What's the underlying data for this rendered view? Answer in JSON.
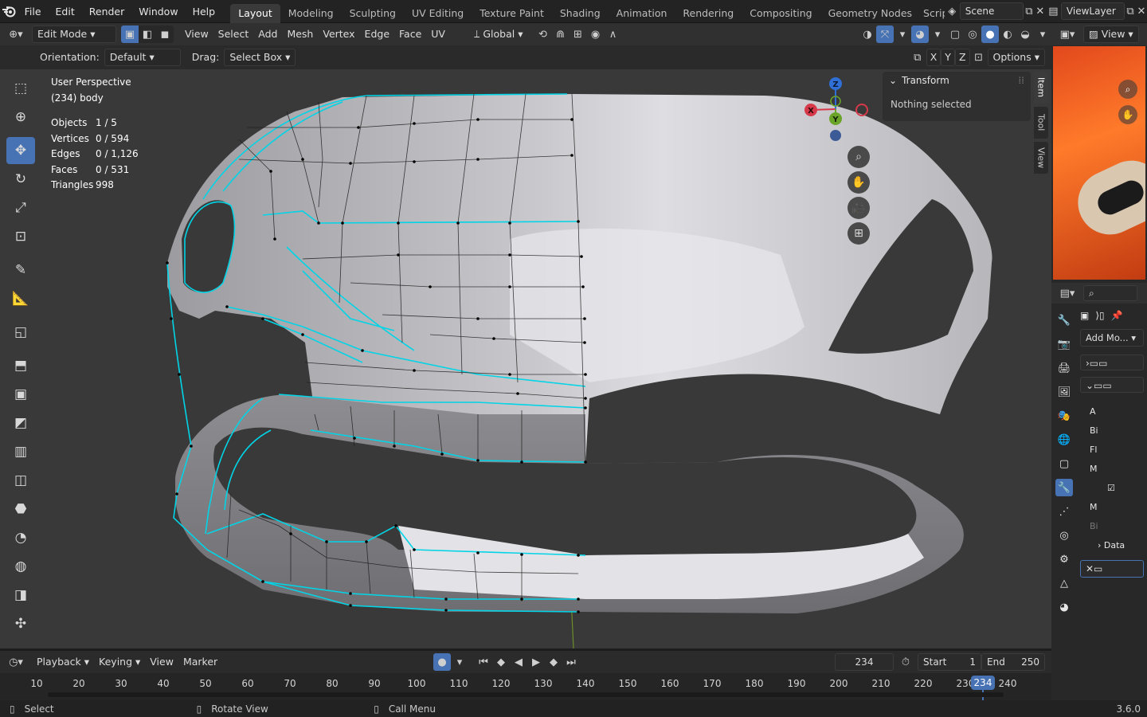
{
  "topbar": {
    "menus": [
      "File",
      "Edit",
      "Render",
      "Window",
      "Help"
    ],
    "workspaces": [
      "Layout",
      "Modeling",
      "Sculpting",
      "UV Editing",
      "Texture Paint",
      "Shading",
      "Animation",
      "Rendering",
      "Compositing",
      "Geometry Nodes",
      "Scripting"
    ],
    "active_workspace": "Layout",
    "scene": "Scene",
    "view_layer": "ViewLayer"
  },
  "header": {
    "mode": "Edit Mode",
    "menus": [
      "View",
      "Select",
      "Add",
      "Mesh",
      "Vertex",
      "Edge",
      "Face",
      "UV"
    ],
    "transform_orientation": "Global"
  },
  "tool_settings": {
    "orientation_label": "Orientation:",
    "orientation_value": "Default",
    "drag_label": "Drag:",
    "drag_value": "Select Box",
    "axes": [
      "X",
      "Y",
      "Z"
    ],
    "options_label": "Options"
  },
  "overlay": {
    "view_name": "User Perspective",
    "object_name": "(234) body",
    "stats": [
      {
        "label": "Objects",
        "value": "1 / 5"
      },
      {
        "label": "Vertices",
        "value": "0 / 594"
      },
      {
        "label": "Edges",
        "value": "0 / 1,126"
      },
      {
        "label": "Faces",
        "value": "0 / 531"
      },
      {
        "label": "Triangles",
        "value": "998"
      }
    ]
  },
  "gizmo": {
    "x": "X",
    "y": "Y",
    "z": "Z"
  },
  "npanel": {
    "section": "Transform",
    "message": "Nothing selected",
    "tabs": [
      "Item",
      "Tool",
      "View"
    ]
  },
  "timeline": {
    "menus": [
      "Playback",
      "Keying",
      "View",
      "Marker"
    ],
    "current_frame": "234",
    "start_label": "Start",
    "start": "1",
    "end_label": "End",
    "end": "250",
    "ticks": [
      "10",
      "20",
      "30",
      "40",
      "50",
      "60",
      "70",
      "80",
      "90",
      "100",
      "110",
      "120",
      "130",
      "140",
      "150",
      "160",
      "170",
      "180",
      "190",
      "200",
      "210",
      "220",
      "230",
      "240"
    ]
  },
  "status": {
    "select": "Select",
    "rotate": "Rotate View",
    "menu": "Call Menu",
    "version": "3.6.0"
  },
  "properties": {
    "add_modifier": "Add Mo...",
    "labels": [
      "A",
      "Bi",
      "Fl",
      "M",
      "M",
      "Bi"
    ],
    "data_label": "Data"
  },
  "colors": {
    "accent": "#4772b3",
    "wire": "#00d4e6",
    "bg": "#393939"
  }
}
